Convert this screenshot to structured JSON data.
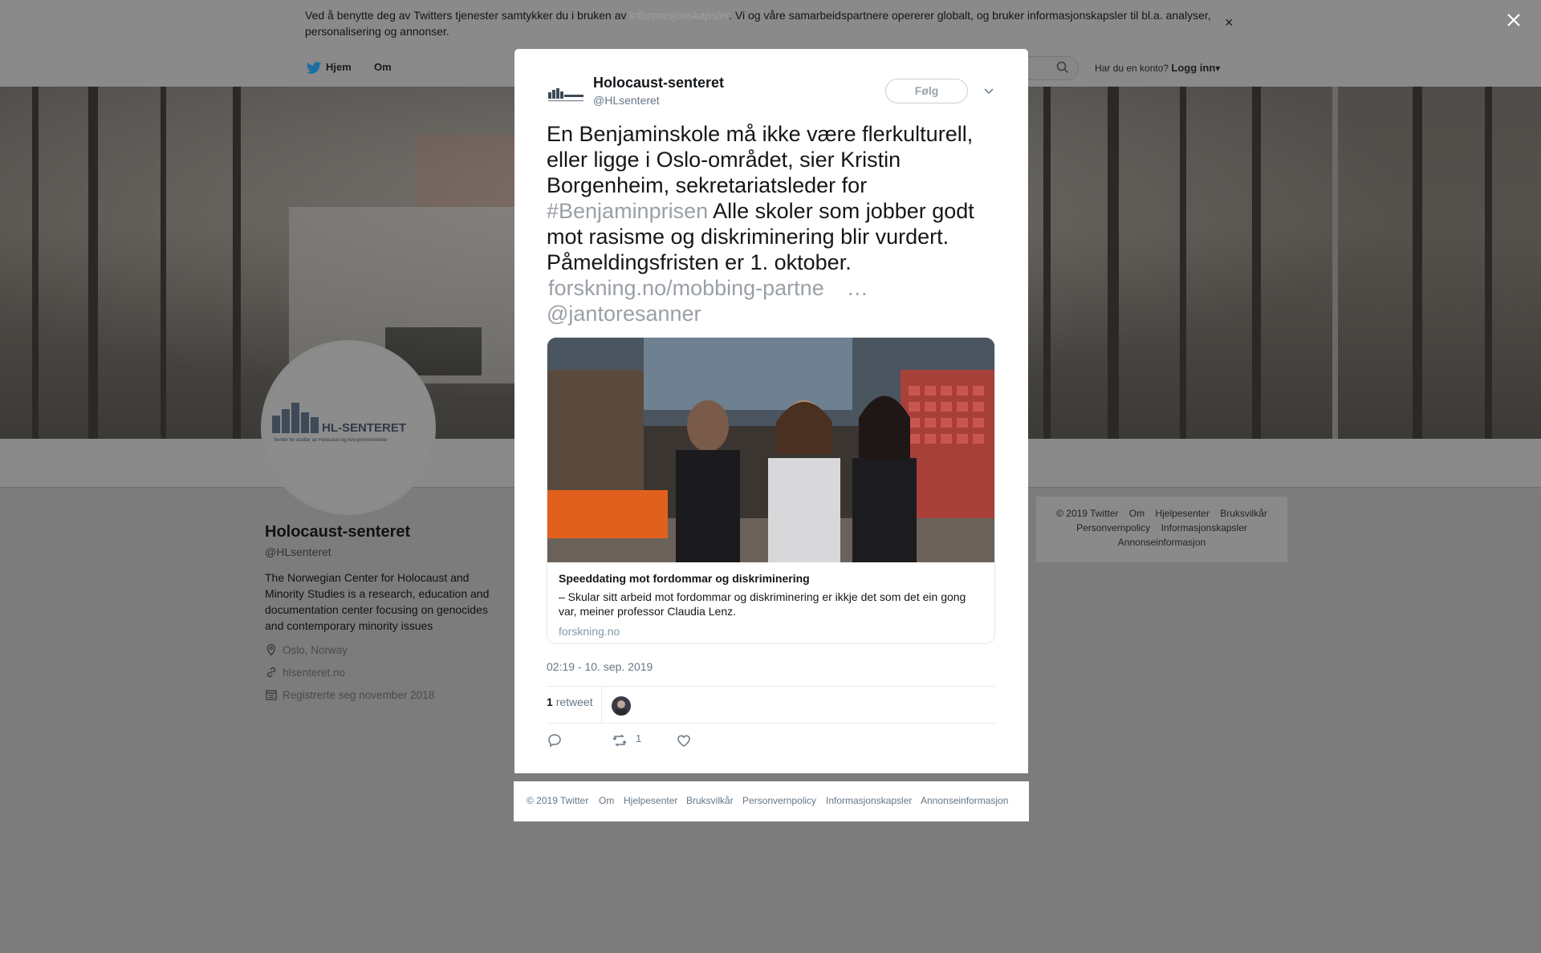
{
  "cookie_banner": {
    "text_before": "Ved å benytte deg av Twitters tjenester samtykker du i bruken av ",
    "link": "informasjonskapsler",
    "text_after": ". Vi og våre samarbeidspartnere opererer globalt, og bruker informasjonskapsler til bl.a. analyser, personalisering og annonser.",
    "close_symbol": "×"
  },
  "nav": {
    "home": "Hjem",
    "about": "Om",
    "account_question": "Har du en konto?",
    "login": "Logg inn"
  },
  "profile": {
    "name": "Holocaust-senteret",
    "handle": "@HLsenteret",
    "bio": "The Norwegian Center for Holocaust and Minority Studies is a research, education and documentation center focusing on genocides and contemporary minority issues",
    "location": "Oslo, Norway",
    "website": "hlsenteret.no",
    "joined": "Registrerte seg november 2018",
    "logo_title": "HL-SENTERET",
    "logo_subtitle": "Senter for studier av Holocaust og livssynsminoriteter"
  },
  "side_footer": [
    "© 2019 Twitter",
    "Om",
    "Hjelpesenter",
    "Bruksvilkår",
    "Personvernpolicy",
    "Informasjonskapsler",
    "Annonseinformasjon"
  ],
  "tweet": {
    "author_name": "Holocaust-senteret",
    "author_handle": "@HLsenteret",
    "follow_label": "Følg",
    "text_part1": "En Benjaminskole må ikke være flerkulturell, eller ligge i Oslo-området, sier Kristin Borgenheim, sekretariatsleder for ",
    "hashtag": "#Benjaminprisen",
    "text_part2": " Alle skoler som jobber godt mot rasisme og diskriminering blir vurdert. Påmeldingsfristen er 1. oktober.",
    "link": "forskning.no/mobbing-partne",
    "ellipsis": "…",
    "mention": "@jantoresanner",
    "card": {
      "title": "Speeddating mot fordommar og diskriminering",
      "description": "– Skular sitt arbeid mot fordommar og diskriminering er ikkje det som det ein gong var, meiner professor Claudia Lenz.",
      "domain": "forskning.no"
    },
    "timestamp": "02:19 - 10. sep. 2019",
    "retweet_count": "1",
    "retweet_label": "retweet",
    "action_retweet_count": "1"
  },
  "modal_footer": [
    "© 2019 Twitter",
    "Om",
    "Hjelpesenter",
    "Bruksvilkår",
    "Personvernpolicy",
    "Informasjonskapsler",
    "Annonseinformasjon"
  ],
  "colors": {
    "twitter_blue": "#1da1f2",
    "overlay": "#7c7c7c",
    "muted_text": "#657786"
  }
}
